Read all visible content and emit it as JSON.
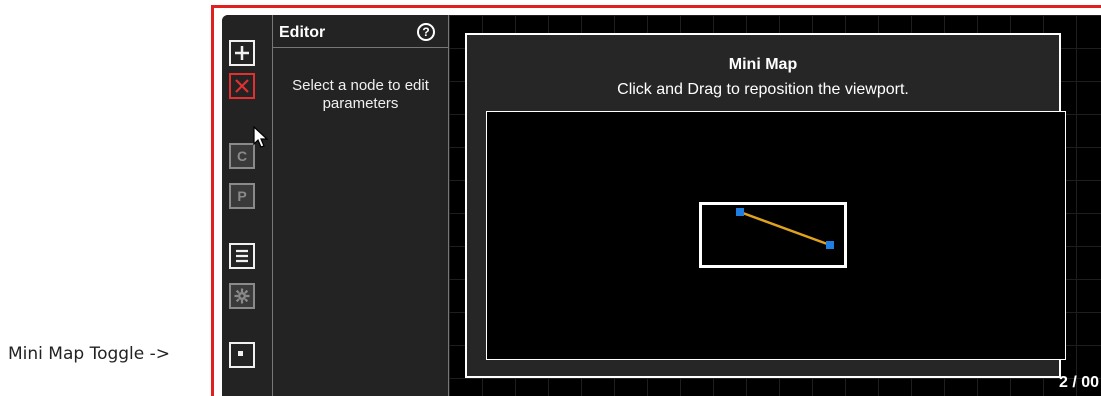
{
  "annotation": {
    "label": "Mini Map Toggle ->"
  },
  "toolbar": {
    "buttons": [
      {
        "name": "add",
        "icon": "plus-icon",
        "enabled": true
      },
      {
        "name": "delete",
        "icon": "close-icon",
        "enabled": true,
        "state": "highlighted"
      },
      {
        "name": "c",
        "label": "C",
        "enabled": false
      },
      {
        "name": "p",
        "label": "P",
        "enabled": false
      },
      {
        "name": "menu",
        "icon": "list-icon",
        "enabled": true
      },
      {
        "name": "settings",
        "icon": "gear-icon",
        "enabled": false
      },
      {
        "name": "minimap-toggle",
        "icon": "minimap-icon",
        "enabled": true
      }
    ]
  },
  "editor": {
    "title": "Editor",
    "help_icon": "?",
    "message": "Select a node to edit parameters"
  },
  "minimap": {
    "title": "Mini Map",
    "subtitle": "Click and Drag to reposition the viewport."
  },
  "canvas": {
    "zoom_text": "2 / 00"
  },
  "colors": {
    "accent_red": "#e02020",
    "node_blue": "#1e7fe0",
    "edge_orange": "#e0a31e"
  }
}
